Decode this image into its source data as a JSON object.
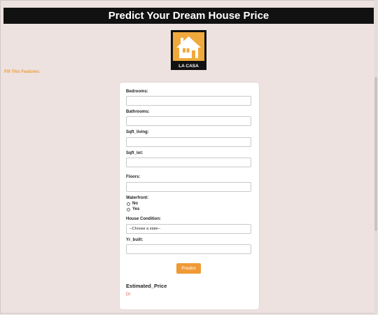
{
  "header": {
    "title": "Predict Your Dream House Price"
  },
  "logo": {
    "text": "LA CASA",
    "icon": "house-icon",
    "bg_color": "#111111",
    "accent_color": "#f0a93c"
  },
  "form": {
    "intro": "Fill This Features:",
    "fields": {
      "bedrooms": {
        "label": "Bedrooms:",
        "value": "",
        "placeholder": ""
      },
      "bathrooms": {
        "label": "Bathrooms:",
        "value": "",
        "placeholder": ""
      },
      "sqft_living": {
        "label": "Sqft_living:",
        "value": "",
        "placeholder": ""
      },
      "sqft_lot": {
        "label": "Sqft_lot:",
        "value": "",
        "placeholder": ""
      },
      "floors": {
        "label": "Floors:",
        "value": "",
        "placeholder": ""
      },
      "waterfront": {
        "label": "Waterfront:",
        "options": [
          "No",
          "Yes"
        ]
      },
      "house_condition": {
        "label": "House Condition:",
        "selected": "--Choose a state--"
      },
      "yr_built": {
        "label": "Yr_built:",
        "value": "",
        "placeholder": ""
      }
    },
    "predict_label": "Predict",
    "result_label": "Estimated_Price",
    "result_value": "DI"
  },
  "colors": {
    "page_bg": "#ede2e0",
    "accent": "#f09a36",
    "result_text": "#e05a4f"
  }
}
